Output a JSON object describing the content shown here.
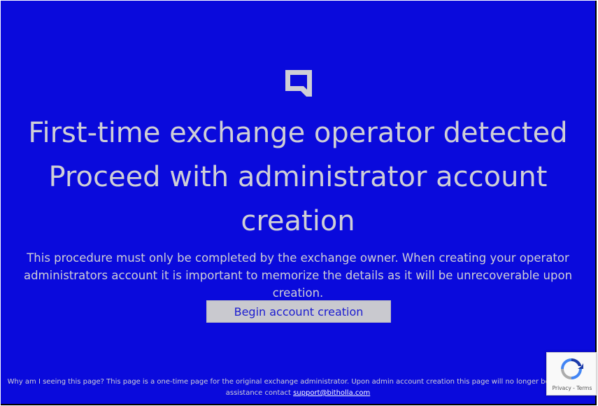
{
  "logo": {
    "icon": "exchange-logo-icon"
  },
  "heading": {
    "line1": "First-time exchange operator detected",
    "line2": "Proceed with administrator account",
    "line3": "creation"
  },
  "description": {
    "line1": "This procedure must only be completed by the exchange owner. When creating your operator",
    "line2": "administrators account it is important to memorize the details as it will be unrecoverable upon creation."
  },
  "begin_button": {
    "label": "Begin account creation"
  },
  "footer": {
    "text_line1": "Why am I seeing this page? This page is a one-time page for the original exchange administrator. Upon admin account creation this page will no longer be reachable.",
    "text_line2": "assistance contact",
    "support_link": "support@bitholla.com"
  },
  "recaptcha": {
    "icon": "recaptcha-icon",
    "privacy_label": "Privacy",
    "separator": "-",
    "terms_label": "Terms"
  },
  "colors": {
    "background": "#0a0adc",
    "text": "#cfcfd6",
    "button_bg": "#c9c9cf",
    "button_text": "#1a1ad0"
  }
}
